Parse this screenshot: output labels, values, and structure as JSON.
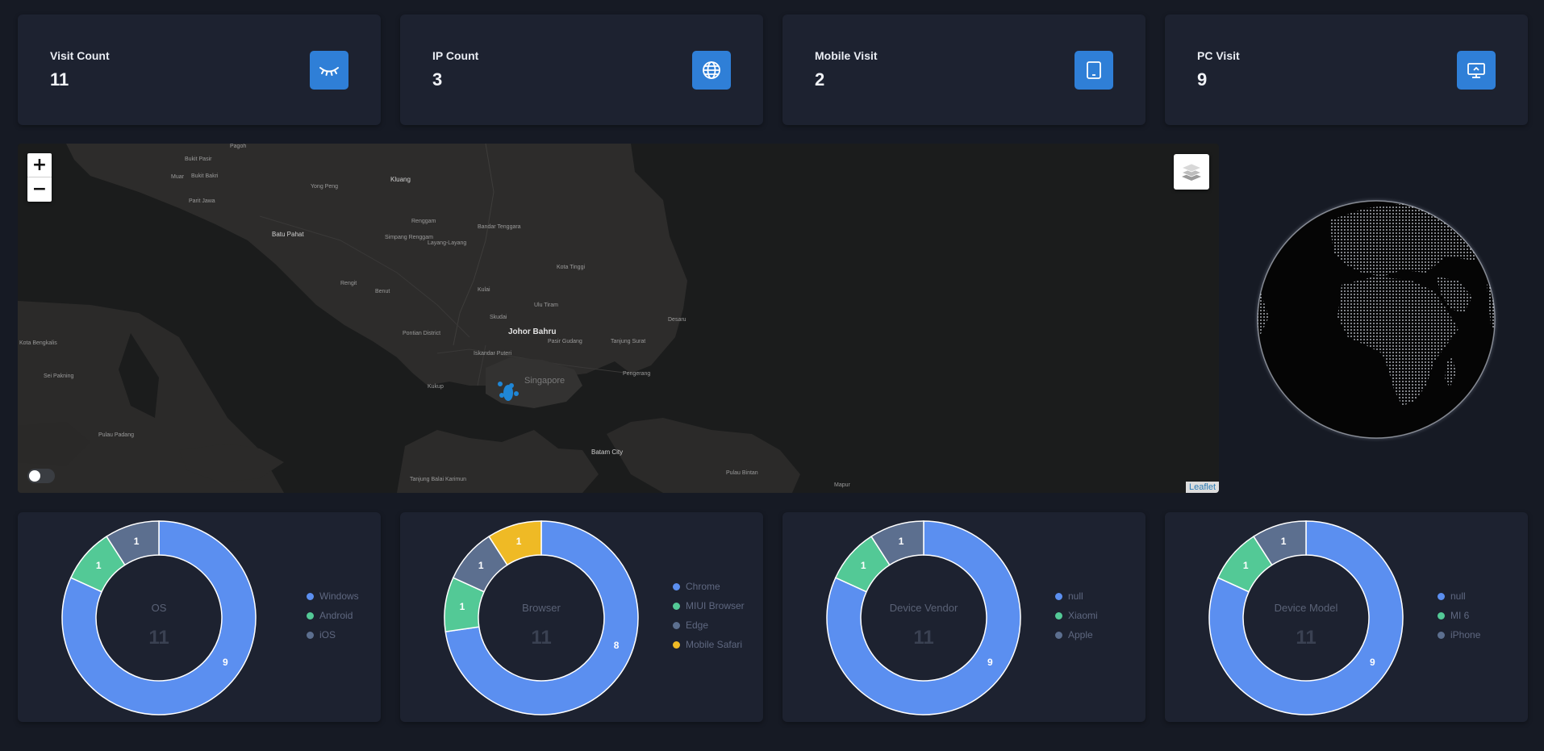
{
  "stats": [
    {
      "title": "Visit Count",
      "value": "11",
      "icon": "eye-closed-icon"
    },
    {
      "title": "IP Count",
      "value": "3",
      "icon": "globe-icon"
    },
    {
      "title": "Mobile Visit",
      "value": "2",
      "icon": "tablet-icon"
    },
    {
      "title": "PC Visit",
      "value": "9",
      "icon": "desktop-icon"
    }
  ],
  "colors": {
    "accent": "#2f7fd7",
    "blue": "#5b8ff0",
    "green": "#53c996",
    "slate": "#5c6f8f",
    "yellow": "#efba25"
  },
  "map": {
    "zoom_in": "+",
    "zoom_out": "−",
    "attribution": "Leaflet",
    "places": {
      "johor_bahru": "Johor Bahru",
      "singapore": "Singapore",
      "batam": "Batam City",
      "kluang": "Kluang",
      "batu_pahat": "Batu Pahat",
      "kota_tinggi": "Kota Tinggi",
      "kulai": "Kulai",
      "skudai": "Skudai",
      "ulu_tiram": "Ulu Tiram",
      "desaru": "Desaru",
      "pontian": "Pontian District",
      "iskandar": "Iskandar Puteri",
      "pasir_gudang": "Pasir Gudang",
      "tanjung_surat": "Tanjung Surat",
      "pengerang": "Pengerang",
      "kukup": "Kukup",
      "benut": "Benut",
      "rengit": "Rengit",
      "renggam": "Renggam",
      "bandar_tenggara": "Bandar Tenggara",
      "simpang_renggam": "Simpang Renggam",
      "layang": "Layang-Layang",
      "yong_peng": "Yong Peng",
      "parit_jawa": "Parit Jawa",
      "muar": "Muar",
      "bukit_bakri": "Bukit Bakri",
      "bukit_pasir": "Bukit Pasir",
      "pagoh": "Pagoh",
      "kota_bengkalis": "Kota Bengkalis",
      "sei_pakning": "Sei Pakning",
      "pulau_padang": "Pulau Padang",
      "pulau_bintan": "Pulau Bintan",
      "tanjung_balai": "Tanjung Balai Karimun",
      "mapur": "Mapur"
    }
  },
  "charts": [
    {
      "title": "OS",
      "total": "11",
      "chart_data": {
        "type": "pie",
        "categories": [
          "Windows",
          "Android",
          "iOS"
        ],
        "values": [
          9,
          1,
          1
        ]
      },
      "legend_colors": [
        "#5b8ff0",
        "#53c996",
        "#5c6f8f"
      ]
    },
    {
      "title": "Browser",
      "total": "11",
      "chart_data": {
        "type": "pie",
        "categories": [
          "Chrome",
          "MIUI Browser",
          "Edge",
          "Mobile Safari"
        ],
        "values": [
          8,
          1,
          1,
          1
        ]
      },
      "legend_colors": [
        "#5b8ff0",
        "#53c996",
        "#5c6f8f",
        "#efba25"
      ]
    },
    {
      "title": "Device Vendor",
      "total": "11",
      "chart_data": {
        "type": "pie",
        "categories": [
          "null",
          "Xiaomi",
          "Apple"
        ],
        "values": [
          9,
          1,
          1
        ]
      },
      "legend_colors": [
        "#5b8ff0",
        "#53c996",
        "#5c6f8f"
      ]
    },
    {
      "title": "Device Model",
      "total": "11",
      "chart_data": {
        "type": "pie",
        "categories": [
          "null",
          "MI 6",
          "iPhone"
        ],
        "values": [
          9,
          1,
          1
        ]
      },
      "legend_colors": [
        "#5b8ff0",
        "#53c996",
        "#5c6f8f"
      ]
    }
  ]
}
